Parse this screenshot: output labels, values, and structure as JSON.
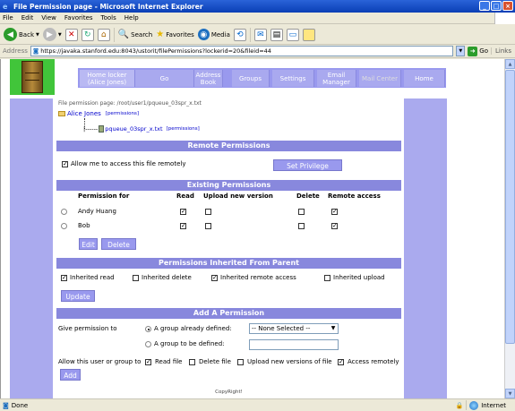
{
  "window": {
    "title": "File Permission page - Microsoft Internet Explorer",
    "min": "_",
    "max": "□",
    "close": "×"
  },
  "menu": [
    "File",
    "Edit",
    "View",
    "Favorites",
    "Tools",
    "Help"
  ],
  "toolbar": {
    "back": "Back",
    "search": "Search",
    "favorites": "Favorites",
    "media": "Media"
  },
  "address": {
    "label": "Address",
    "url": "https://javaka.stanford.edu:8043/ustorit/filePermissions?lockerid=20&fileid=44",
    "go": "Go",
    "links": "Links"
  },
  "nav": [
    "Home locker\n(Alice Jones)",
    "Go",
    "Address\nBook",
    "Groups",
    "Settings",
    "Email\nManager",
    "Mail Center",
    "Home"
  ],
  "page": {
    "path": "File permission page: /root/user1/pqueue_03spr_x.txt",
    "owner": "Alice Jones",
    "permissions_link": "[permissions]",
    "file_prefix": "|------",
    "file": "pqueue_03spr_x.txt",
    "file_permissions_link": "[permissions]"
  },
  "remote": {
    "title": "Remote Permissions",
    "allow_label": "Allow me to access this file remotely",
    "allow_checked": true,
    "set_button": "Set Privilege"
  },
  "existing": {
    "title": "Existing Permissions",
    "columns": [
      "Permission for",
      "Read",
      "Upload new version",
      "Delete",
      "Remote access"
    ],
    "rows": [
      {
        "name": "Andy Huang",
        "read": true,
        "upload": false,
        "delete": false,
        "remote": true
      },
      {
        "name": "Bob",
        "read": true,
        "upload": false,
        "delete": false,
        "remote": true
      }
    ],
    "edit_button": "Edit",
    "delete_button": "Delete"
  },
  "inherited": {
    "title": "Permissions Inherited From Parent",
    "items": [
      {
        "label": "Inherited read",
        "checked": true
      },
      {
        "label": "Inherited delete",
        "checked": false
      },
      {
        "label": "Inherited remote access",
        "checked": true
      },
      {
        "label": "Inherited upload",
        "checked": false
      }
    ],
    "update_button": "Update"
  },
  "add": {
    "title": "Add A Permission",
    "give_label": "Give permission to",
    "group_defined_label": "A group already defined:",
    "group_select_value": "-- None Selected --",
    "group_new_label": "A group to be defined:",
    "allow_label": "Allow this user or group to",
    "options": [
      {
        "label": "Read file",
        "checked": true
      },
      {
        "label": "Delete file",
        "checked": false
      },
      {
        "label": "Upload new versions of file",
        "checked": false
      },
      {
        "label": "Access remotely",
        "checked": true
      }
    ],
    "add_button": "Add"
  },
  "copyright": "CopyRight!",
  "status": {
    "text": "Done",
    "zone": "Internet"
  }
}
